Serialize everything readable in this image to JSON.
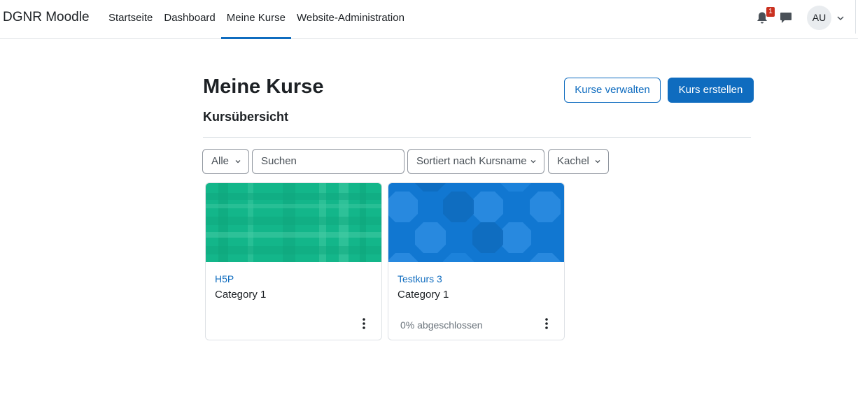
{
  "navbar": {
    "brand": "DGNR Moodle",
    "items": [
      {
        "label": "Startseite",
        "active": false
      },
      {
        "label": "Dashboard",
        "active": false
      },
      {
        "label": "Meine Kurse",
        "active": true
      },
      {
        "label": "Website-Administration",
        "active": false
      }
    ],
    "notification_count": "1",
    "avatar_initials": "AU",
    "icons": [
      "bell-icon",
      "chat-icon",
      "chevron-down-icon"
    ]
  },
  "header": {
    "title": "Meine Kurse",
    "manage_button": "Kurse verwalten",
    "create_button": "Kurs erstellen",
    "section_title": "Kursübersicht"
  },
  "filters": {
    "grouping": "Alle",
    "search_placeholder": "Suchen",
    "sort": "Sortiert nach Kursname",
    "view": "Kachel"
  },
  "courses": [
    {
      "name": "H5P",
      "category": "Category 1",
      "progress": "",
      "image_color": "#13b68a"
    },
    {
      "name": "Testkurs 3",
      "category": "Category 1",
      "progress": "0% abgeschlossen",
      "image_color": "#1177d1"
    }
  ],
  "colors": {
    "primary": "#0f6cbf",
    "badge": "#ca3120",
    "text": "#1d2125"
  }
}
